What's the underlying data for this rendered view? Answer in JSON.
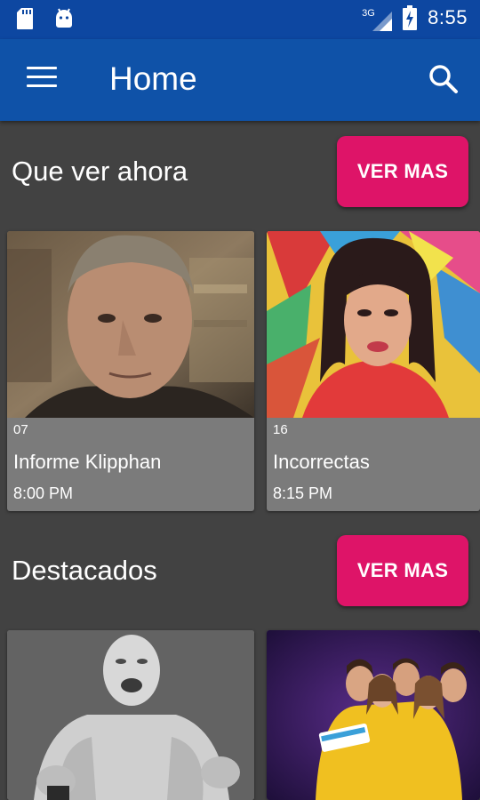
{
  "status_bar": {
    "network": "3G",
    "time": "8:55",
    "icons": [
      "sd-card-icon",
      "android-icon",
      "signal-icon",
      "battery-charging-icon"
    ]
  },
  "app_bar": {
    "title": "Home",
    "menu_icon": "menu-icon",
    "search_icon": "search-icon"
  },
  "sections": [
    {
      "title": "Que ver ahora",
      "button": "VER MAS",
      "cards": [
        {
          "channel": "07",
          "show": "Informe Klipphan",
          "time": "8:00 PM"
        },
        {
          "channel": "16",
          "show": "Incorrectas",
          "time": "8:15 PM"
        }
      ]
    },
    {
      "title": "Destacados",
      "button": "VER MAS",
      "cards": [
        {
          "channel": "",
          "show": "",
          "time": ""
        },
        {
          "channel": "",
          "show": "",
          "time": ""
        }
      ]
    }
  ],
  "colors": {
    "status_bar": "#0d47a1",
    "app_bar": "#0f52a8",
    "background": "#424242",
    "accent": "#de1468",
    "card": "#7b7b7b"
  }
}
